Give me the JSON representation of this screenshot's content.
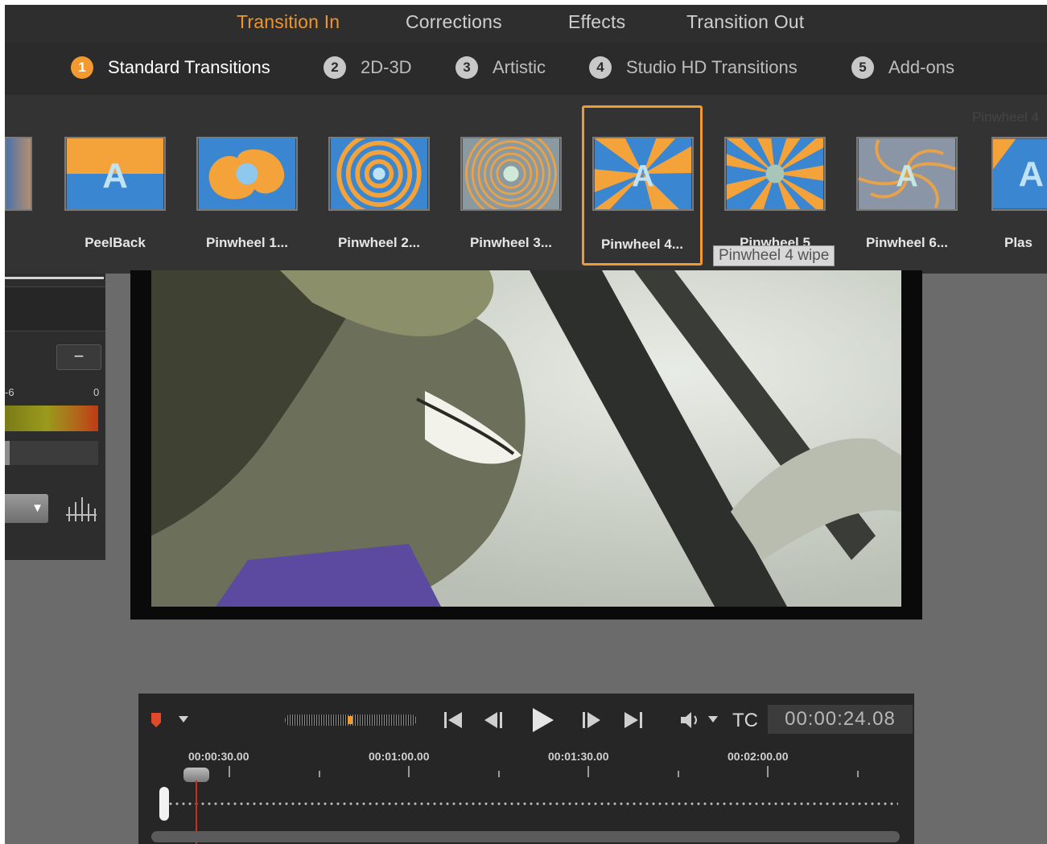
{
  "tabs": [
    {
      "label": "Transition In",
      "active": true
    },
    {
      "label": "Corrections",
      "active": false
    },
    {
      "label": "Effects",
      "active": false
    },
    {
      "label": "Transition Out",
      "active": false
    }
  ],
  "categories": [
    {
      "num": "1",
      "label": "Standard Transitions",
      "active": true
    },
    {
      "num": "2",
      "label": "2D-3D",
      "active": false
    },
    {
      "num": "3",
      "label": "Artistic",
      "active": false
    },
    {
      "num": "4",
      "label": "Studio HD Transitions",
      "active": false
    },
    {
      "num": "5",
      "label": "Add-ons",
      "active": false
    }
  ],
  "strip_hint": "Pinwheel 4",
  "thumbnails": [
    {
      "label": "PeelBack",
      "icon": "peelback-thumbnail-icon"
    },
    {
      "label": "Pinwheel 1...",
      "icon": "pinwheel-1-thumbnail-icon"
    },
    {
      "label": "Pinwheel 2...",
      "icon": "pinwheel-2-thumbnail-icon"
    },
    {
      "label": "Pinwheel 3...",
      "icon": "pinwheel-3-thumbnail-icon"
    },
    {
      "label": "Pinwheel 4...",
      "icon": "pinwheel-4-thumbnail-icon",
      "selected": true
    },
    {
      "label": "Pinwheel 5",
      "icon": "pinwheel-5-thumbnail-icon"
    },
    {
      "label": "Pinwheel 6...",
      "icon": "pinwheel-6-thumbnail-icon"
    },
    {
      "label": "Plas",
      "icon": "plasma-thumbnail-icon"
    }
  ],
  "tooltip": "Pinwheel 4 wipe",
  "audio": {
    "scale_left": "-6",
    "scale_right": "0",
    "minus_label": "−"
  },
  "transport": {
    "tc_label": "TC",
    "timecode": "00:00:24.08",
    "ticks": [
      "00:00:30.00",
      "00:01:00.00",
      "00:01:30.00",
      "00:02:00.00"
    ]
  },
  "colors": {
    "accent": "#f29a30",
    "thumb_orange": "#f4a23a",
    "thumb_blue": "#3b86d0"
  }
}
